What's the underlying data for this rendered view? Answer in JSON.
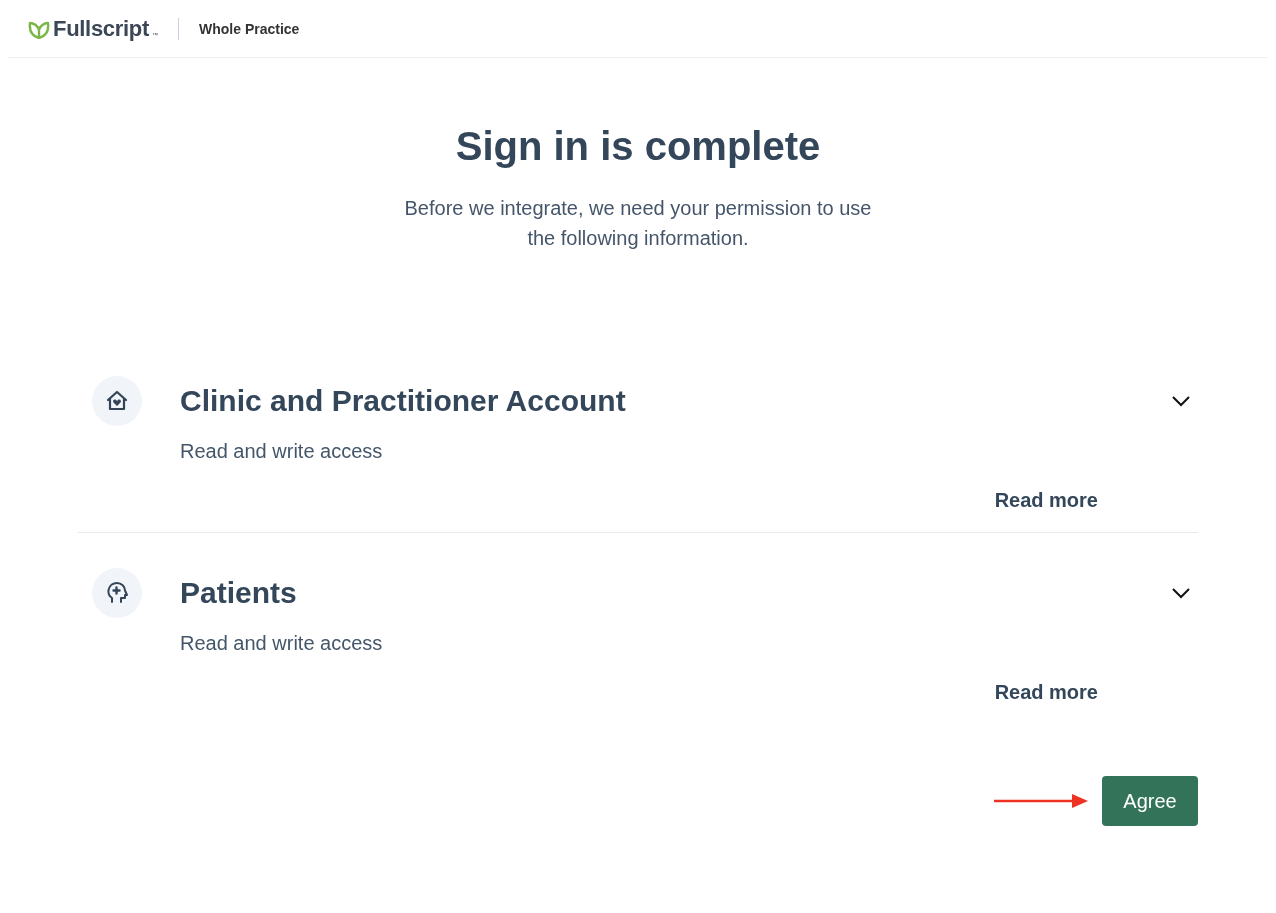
{
  "header": {
    "brand": "Fullscript",
    "trademark": "™",
    "product": "Whole Practice"
  },
  "title": "Sign in is complete",
  "subtitle": "Before we integrate, we need your permission to use the following information.",
  "permissions": [
    {
      "kind": "house",
      "title": "Clinic and Practitioner Account",
      "access": "Read and write access",
      "link": "Read more",
      "expanded": false
    },
    {
      "kind": "head",
      "title": "Patients",
      "access": "Read and write access",
      "link": "Read more",
      "expanded": false
    }
  ],
  "agree_button": "Agree"
}
